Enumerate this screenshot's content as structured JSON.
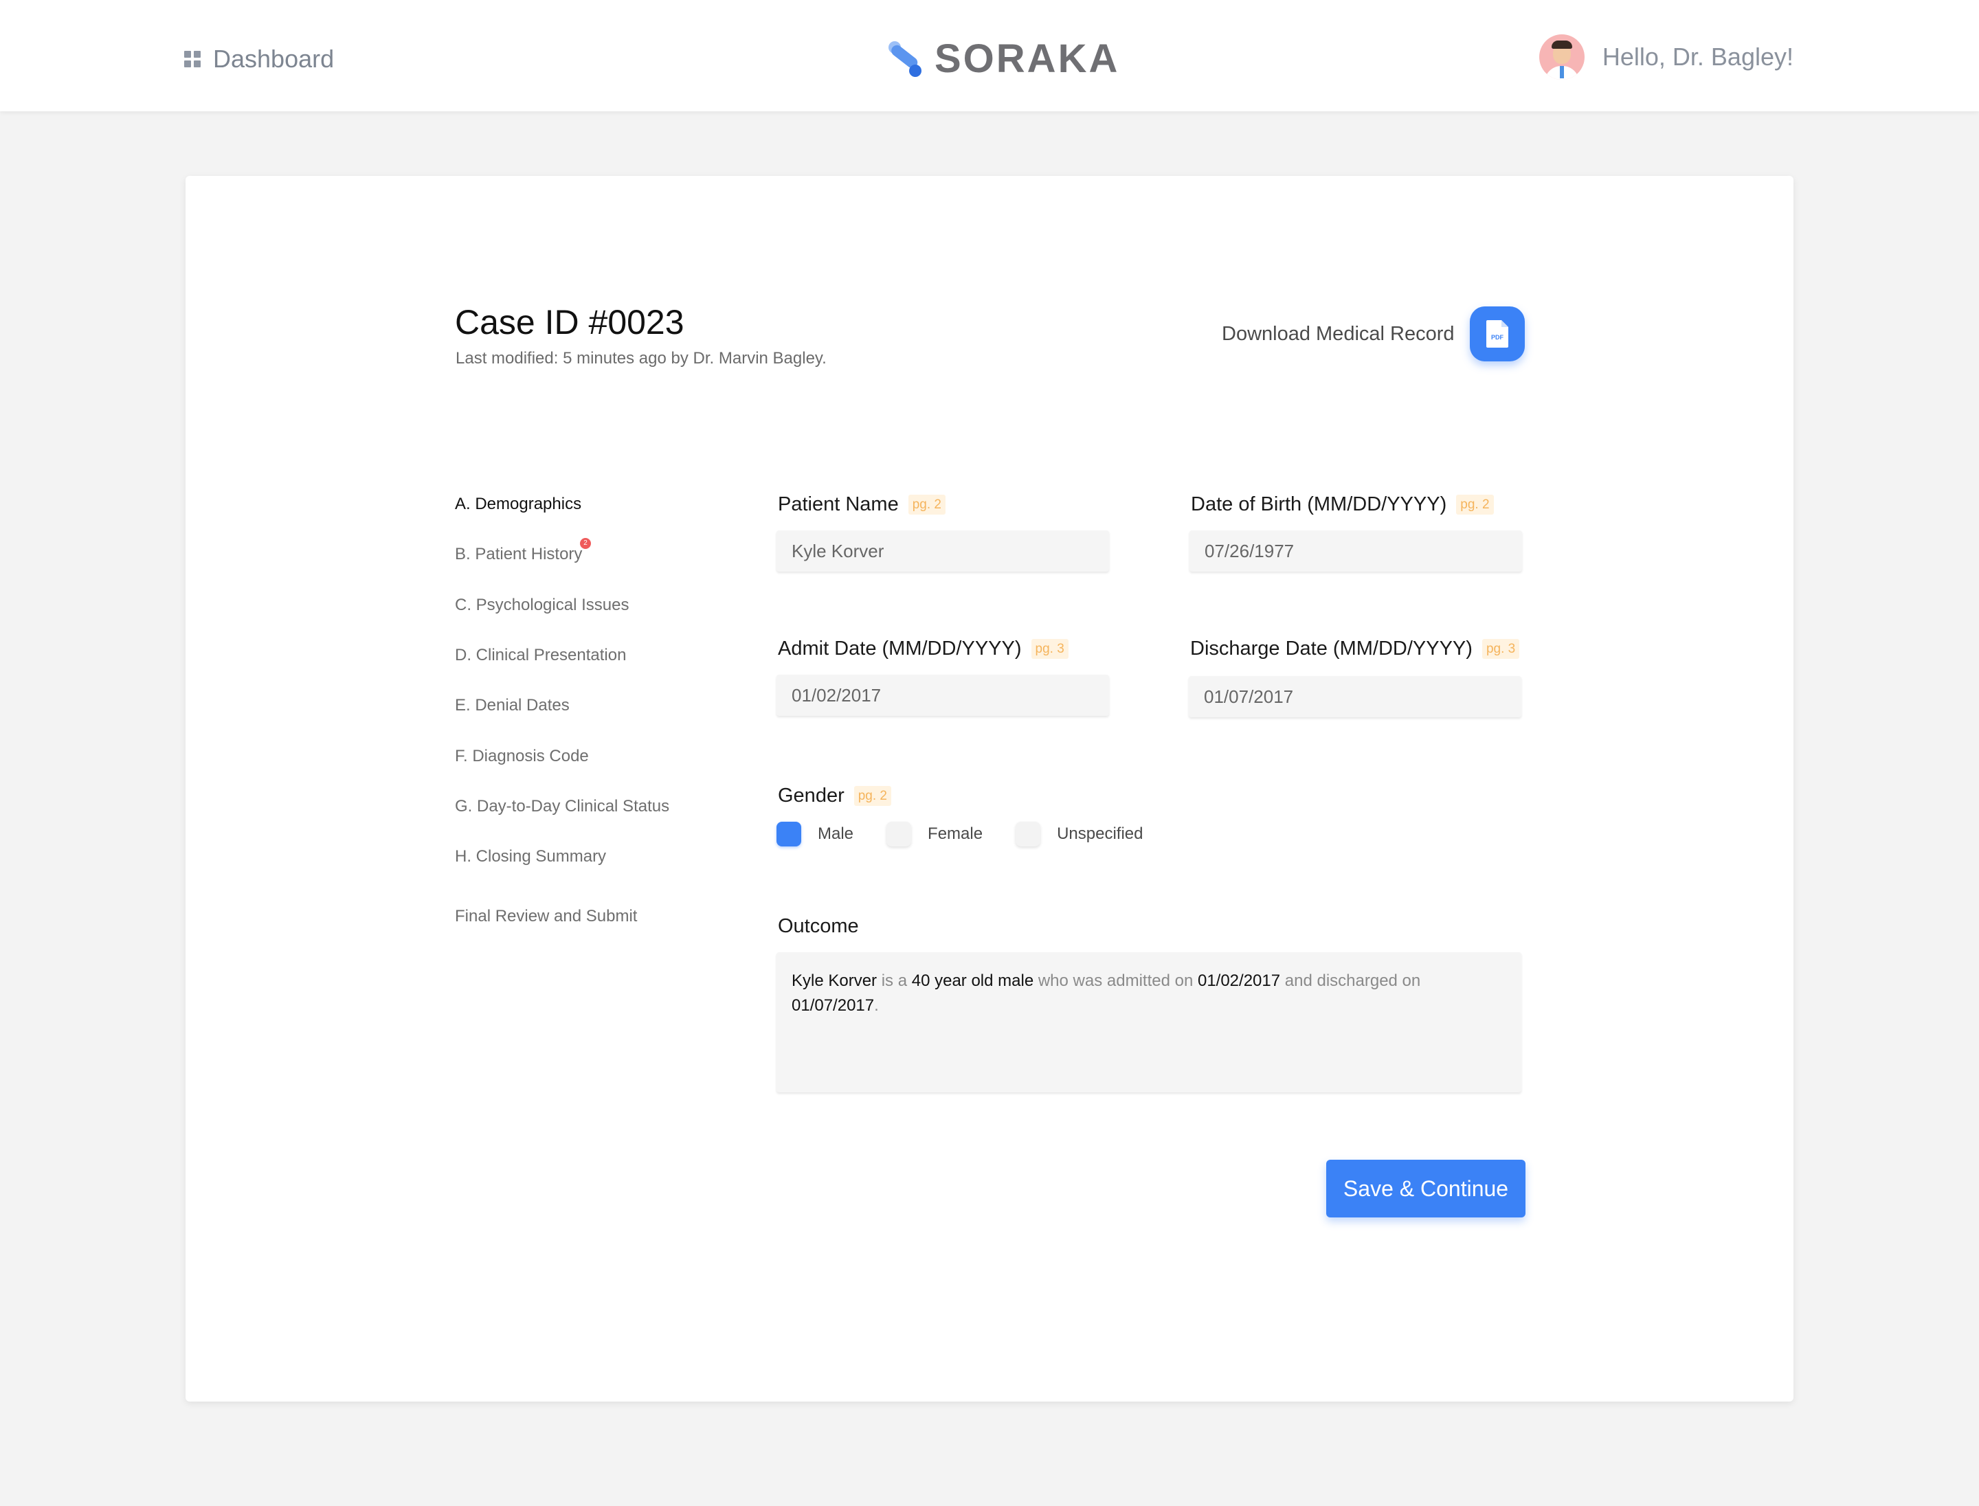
{
  "header": {
    "dashboard_label": "Dashboard",
    "brand_name": "SORAKA",
    "greeting": "Hello, Dr. Bagley!"
  },
  "case": {
    "title": "Case ID #0023",
    "last_modified": "Last modified: 5 minutes ago by Dr. Marvin Bagley.",
    "download_label": "Download Medical Record",
    "pdf_icon_text": "PDF"
  },
  "sidebar": {
    "items": [
      {
        "label": "A. Demographics",
        "active": true
      },
      {
        "label": "B. Patient History",
        "badge": "2"
      },
      {
        "label": "C. Psychological Issues"
      },
      {
        "label": "D. Clinical Presentation"
      },
      {
        "label": "E. Denial Dates"
      },
      {
        "label": "F. Diagnosis Code"
      },
      {
        "label": "G. Day-to-Day Clinical Status"
      },
      {
        "label": "H. Closing Summary"
      },
      {
        "label": "Final Review and Submit"
      }
    ]
  },
  "form": {
    "patient_name": {
      "label": "Patient Name",
      "page": "pg. 2",
      "value": "Kyle Korver"
    },
    "dob": {
      "label": "Date of Birth (MM/DD/YYYY)",
      "page": "pg. 2",
      "value": "07/26/1977"
    },
    "admit_date": {
      "label": "Admit Date (MM/DD/YYYY)",
      "page": "pg. 3",
      "value": "01/02/2017"
    },
    "discharge_date": {
      "label": "Discharge Date (MM/DD/YYYY)",
      "page": "pg. 3",
      "value": "01/07/2017"
    },
    "gender": {
      "label": "Gender",
      "page": "pg. 2",
      "options": [
        "Male",
        "Female",
        "Unspecified"
      ],
      "selected": "Male"
    },
    "outcome": {
      "label": "Outcome",
      "segments": {
        "name": "Kyle Korver",
        "t1": " is a ",
        "age": "40 year old male",
        "t2": " who was admitted on ",
        "admit": "01/02/2017",
        "t3": " and discharged on ",
        "discharge": "01/07/2017",
        "t4": "."
      }
    },
    "save_label": "Save & Continue"
  },
  "colors": {
    "accent": "#3b82f6",
    "page_tag_bg": "#fff3e0",
    "page_tag_text": "#f5b45c",
    "badge": "#ef5b5b",
    "background": "#f3f3f3"
  }
}
